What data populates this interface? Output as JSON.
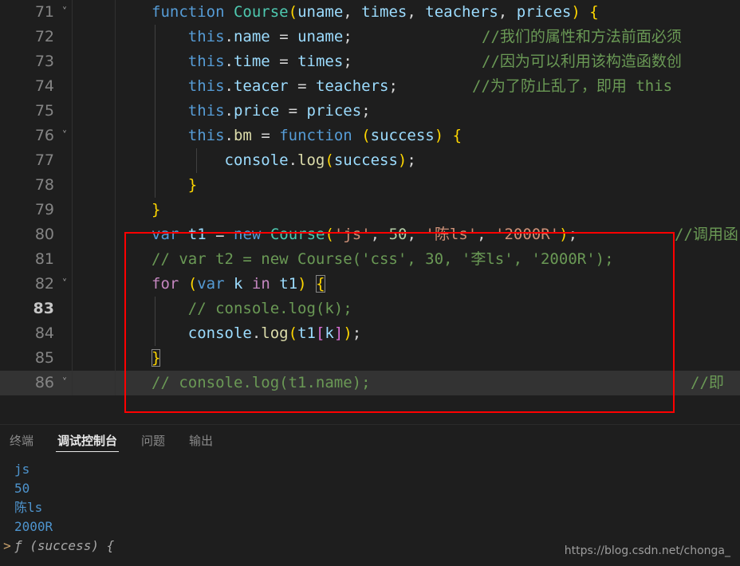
{
  "editor": {
    "language": "javascript",
    "current_line": 83,
    "theme_background": "#1e1e1e",
    "annotation_box_color": "#ff0000",
    "lines": [
      {
        "number": "71",
        "fold": "chevron-down-icon",
        "text": "function Course(uname, times, teachers, prices) {"
      },
      {
        "number": "72",
        "fold": "",
        "text": "    this.name = uname;",
        "comment": "//我们的属性和方法前面必须"
      },
      {
        "number": "73",
        "fold": "",
        "text": "    this.time = times;",
        "comment": "//因为可以利用该构造函数创"
      },
      {
        "number": "74",
        "fold": "",
        "text": "    this.teacer = teachers;",
        "comment": "//为了防止乱了，即用 this"
      },
      {
        "number": "75",
        "fold": "",
        "text": "    this.price = prices;"
      },
      {
        "number": "76",
        "fold": "chevron-down-icon",
        "text": "    this.bm = function (success) {"
      },
      {
        "number": "77",
        "fold": "",
        "text": "        console.log(success);"
      },
      {
        "number": "78",
        "fold": "",
        "text": "    }"
      },
      {
        "number": "79",
        "fold": "",
        "text": "}"
      },
      {
        "number": "80",
        "fold": "",
        "text": "var t1 = new Course('js', 50, '陈ls', '2000R');",
        "comment": "//调用函"
      },
      {
        "number": "81",
        "fold": "",
        "text": "// var t2 = new Course('css', 30, '李ls', '2000R');"
      },
      {
        "number": "82",
        "fold": "chevron-down-icon",
        "text": "for (var k in t1) {"
      },
      {
        "number": "83",
        "fold": "",
        "text": "    // console.log(k);"
      },
      {
        "number": "84",
        "fold": "",
        "text": "    console.log(t1[k]);"
      },
      {
        "number": "85",
        "fold": "",
        "text": "}"
      },
      {
        "number": "86",
        "fold": "chevron-down-icon",
        "text": "// console.log(t1.name);",
        "comment": "//即"
      }
    ]
  },
  "panel": {
    "tabs": [
      {
        "label": "终端",
        "active": false
      },
      {
        "label": "调试控制台",
        "active": true
      },
      {
        "label": "问题",
        "active": false
      },
      {
        "label": "输出",
        "active": false
      }
    ],
    "console_output": [
      {
        "text": "js",
        "type": "value"
      },
      {
        "text": "50",
        "type": "value"
      },
      {
        "text": "陈ls",
        "type": "value"
      },
      {
        "text": "2000R",
        "type": "value"
      },
      {
        "text": "ƒ (success) {",
        "type": "function",
        "prompt": ">"
      }
    ]
  },
  "watermark": {
    "text": "https://blog.csdn.net/chonga_"
  },
  "colors": {
    "keyword": "#569cd6",
    "control": "#c586c0",
    "type": "#4ec9b0",
    "variable": "#9cdcfe",
    "function": "#dcdcaa",
    "string": "#ce9178",
    "number": "#b5cea8",
    "comment": "#6a9955",
    "plain": "#d4d4d4",
    "console_value": "#4e94ce",
    "annotation": "#ff0000"
  }
}
